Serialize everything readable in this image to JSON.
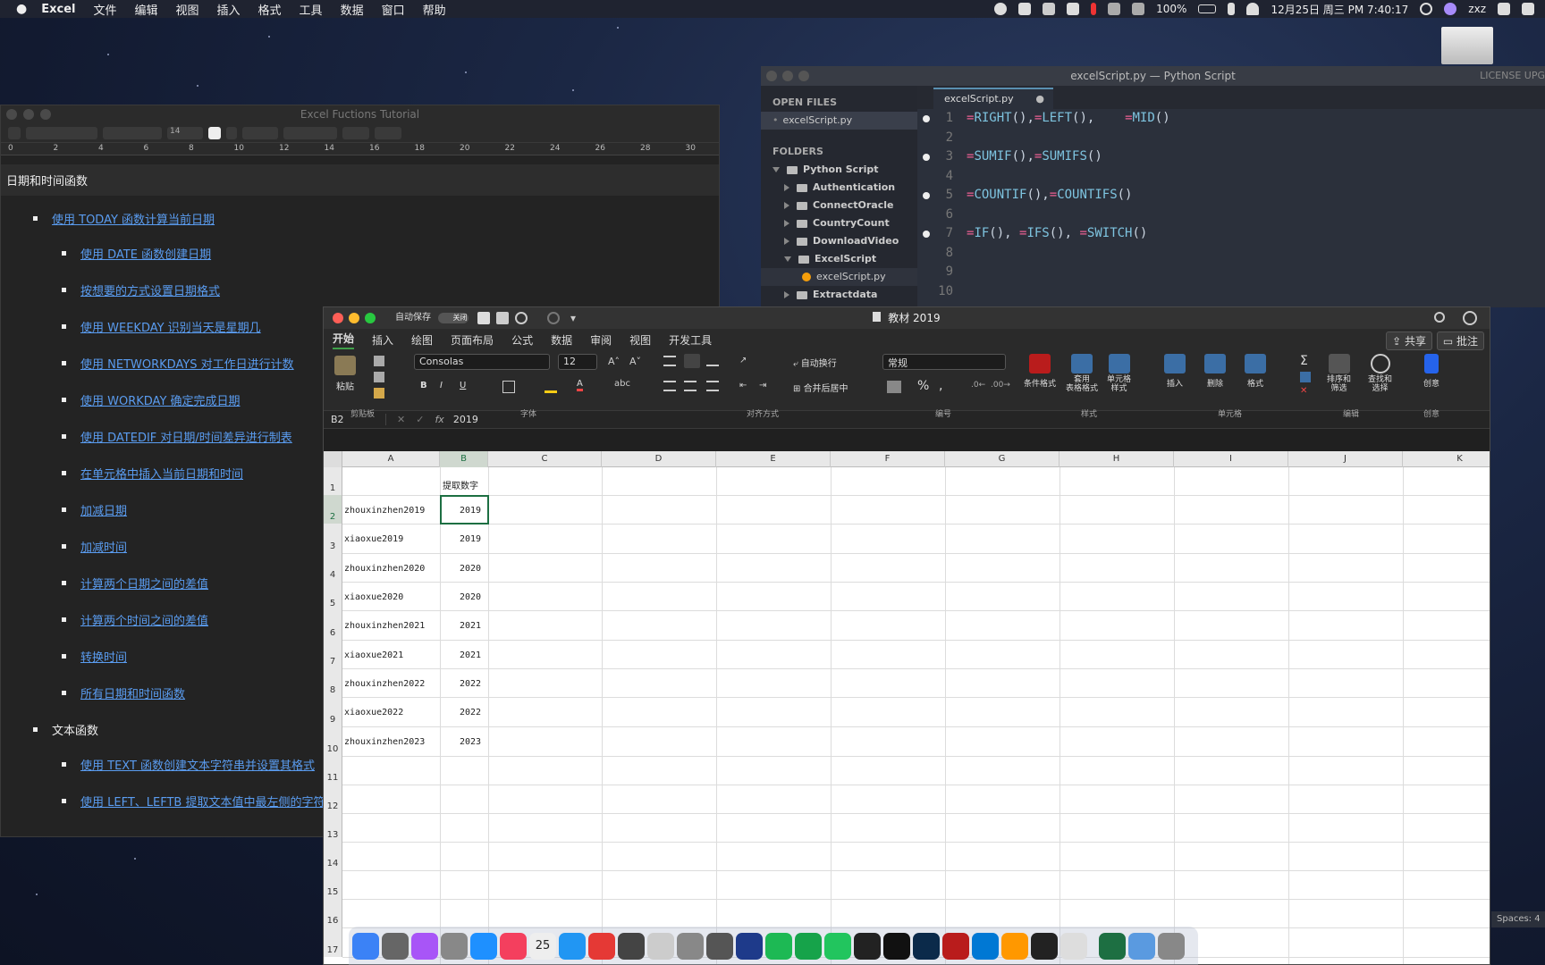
{
  "menubar": {
    "app": "Excel",
    "items": [
      "文件",
      "编辑",
      "视图",
      "插入",
      "格式",
      "工具",
      "数据",
      "窗口",
      "帮助"
    ],
    "battery": "100%",
    "datetime": "12月25日 周三 PM 7:40:17",
    "user": "zxz"
  },
  "tutorial": {
    "title": "Excel Fuctions Tutorial",
    "font_size_value": "14",
    "ruler_ticks": [
      "0",
      "2",
      "4",
      "6",
      "8",
      "10",
      "12",
      "14",
      "16",
      "18",
      "20",
      "22",
      "24",
      "26",
      "28",
      "30"
    ],
    "section1": "日期和时间函数",
    "item_main": "使用 TODAY 函数计算当前日期",
    "items": [
      "使用 DATE 函数创建日期",
      "按想要的方式设置日期格式",
      "使用 WEEKDAY 识别当天是星期几",
      "使用 NETWORKDAYS 对工作日进行计数",
      "使用 WORKDAY 确定完成日期",
      "使用 DATEDIF 对日期/时间差异进行制表",
      "在单元格中插入当前日期和时间",
      "加减日期",
      "加减时间",
      "计算两个日期之间的差值",
      "计算两个时间之间的差值",
      "转换时间",
      "所有日期和时间函数"
    ],
    "section2": "文本函数",
    "text_items": [
      "使用 TEXT 函数创建文本字符串并设置其格式",
      "使用 LEFT、LEFTB 提取文本值中最左侧的字符"
    ]
  },
  "sublime": {
    "title": "excelScript.py — Python Script",
    "license": "LICENSE UPG",
    "open_files_header": "OPEN FILES",
    "open_file": "excelScript.py",
    "folders_header": "FOLDERS",
    "root_folder": "Python Script",
    "folders": [
      "Authentication",
      "ConnectOracle",
      "CountryCount",
      "DownloadVideo",
      "ExcelScript"
    ],
    "sub_file": "excelScript.py",
    "last_folder": "Extractdata",
    "tab": "excelScript.py",
    "line_numbers": [
      "1",
      "2",
      "3",
      "4",
      "5",
      "6",
      "7",
      "8",
      "9",
      "10"
    ],
    "lines": [
      {
        "n": 1,
        "parts": [
          [
            "eq",
            "="
          ],
          [
            "fn",
            "RIGHT"
          ],
          [
            "p",
            "(),"
          ],
          [
            "eq",
            "="
          ],
          [
            "fn",
            "LEFT"
          ],
          [
            "p",
            "(),    "
          ],
          [
            "eq",
            "="
          ],
          [
            "fn",
            "MID"
          ],
          [
            "p",
            "()"
          ]
        ]
      },
      {
        "n": 3,
        "parts": [
          [
            "eq",
            "="
          ],
          [
            "fn",
            "SUMIF"
          ],
          [
            "p",
            "(),"
          ],
          [
            "eq",
            "="
          ],
          [
            "fn",
            "SUMIFS"
          ],
          [
            "p",
            "()"
          ]
        ]
      },
      {
        "n": 5,
        "parts": [
          [
            "eq",
            "="
          ],
          [
            "fn",
            "COUNTIF"
          ],
          [
            "p",
            "(),"
          ],
          [
            "eq",
            "="
          ],
          [
            "fn",
            "COUNTIFS"
          ],
          [
            "p",
            "()"
          ]
        ]
      },
      {
        "n": 7,
        "parts": [
          [
            "eq",
            "="
          ],
          [
            "fn",
            "IF"
          ],
          [
            "p",
            "(), "
          ],
          [
            "eq",
            "="
          ],
          [
            "fn",
            "IFS"
          ],
          [
            "p",
            "(), "
          ],
          [
            "eq",
            "="
          ],
          [
            "fn",
            "SWITCH"
          ],
          [
            "p",
            "()"
          ]
        ]
      }
    ],
    "spaces": "Spaces: 4"
  },
  "excel": {
    "title": "教材 2019",
    "autosave": "自动保存",
    "autosave_state": "关闭",
    "tabs": [
      "开始",
      "插入",
      "绘图",
      "页面布局",
      "公式",
      "数据",
      "审阅",
      "视图",
      "开发工具"
    ],
    "share": "共享",
    "comment": "批注",
    "paste": "粘贴",
    "font": "Consolas",
    "font_size": "12",
    "wrap": "自动换行",
    "merge": "合并后居中",
    "number_format": "常规",
    "cond_format": "条件格式",
    "table_format": "套用\n表格格式",
    "cell_style": "单元格\n样式",
    "insert": "插入",
    "delete": "删除",
    "format": "格式",
    "sort": "排序和\n筛选",
    "find": "查找和\n选择",
    "create": "创意",
    "groups": [
      "剪贴板",
      "字体",
      "对齐方式",
      "编号",
      "样式",
      "单元格",
      "编辑",
      "创意"
    ],
    "name_box": "B2",
    "fx": "fx",
    "formula": "2019",
    "columns": [
      "A",
      "B",
      "C",
      "D",
      "E",
      "F",
      "G",
      "H",
      "I",
      "J",
      "K"
    ],
    "rows": [
      "1",
      "2",
      "3",
      "4",
      "5",
      "6",
      "7",
      "8",
      "9",
      "10",
      "11",
      "12",
      "13",
      "14",
      "15",
      "16",
      "17"
    ],
    "b1": "提取数字",
    "data": [
      [
        "zhouxinzhen2019",
        "2019"
      ],
      [
        "xiaoxue2019",
        "2019"
      ],
      [
        "zhouxinzhen2020",
        "2020"
      ],
      [
        "xiaoxue2020",
        "2020"
      ],
      [
        "zhouxinzhen2021",
        "2021"
      ],
      [
        "xiaoxue2021",
        "2021"
      ],
      [
        "zhouxinzhen2022",
        "2022"
      ],
      [
        "xiaoxue2022",
        "2022"
      ],
      [
        "zhouxinzhen2023",
        "2023"
      ]
    ]
  },
  "dock": {
    "items": [
      "finder-icon",
      "system-preferences-icon",
      "siri-icon",
      "launchpad-icon",
      "app-store-icon",
      "music-icon",
      "calendar-icon",
      "safari-icon",
      "chrome-icon",
      "final-cut-icon",
      "instruments-icon",
      "automator-icon",
      "disk-utility-icon",
      "quicktime-icon",
      "spotify-icon",
      "evernote-icon",
      "wechat-icon",
      "activity-monitor-icon",
      "terminal-icon",
      "photoshop-icon",
      "winrar-icon",
      "outlook-icon",
      "sublime-icon",
      "qq-icon",
      "notes-icon",
      "excel-icon",
      "folder-icon",
      "trash-icon"
    ],
    "calendar_day": "25",
    "colors": [
      "#3b82f6",
      "#666",
      "#a855f7",
      "#888",
      "#1e90ff",
      "#f43f5e",
      "#eee",
      "#2196f3",
      "#e53935",
      "#444",
      "#ccc",
      "#888",
      "#555",
      "#1e3a8a",
      "#1db954",
      "#16a34a",
      "#22c55e",
      "#222",
      "#111",
      "#0b2a4a",
      "#b91c1c",
      "#0078d4",
      "#ff9800",
      "#222",
      "#ddd",
      "#1d6f42",
      "#5a9ae0",
      "#888"
    ]
  }
}
